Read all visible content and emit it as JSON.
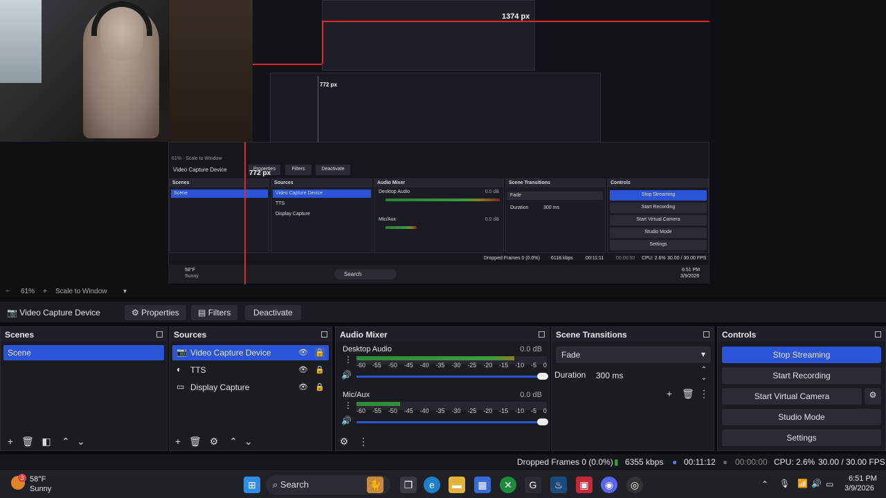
{
  "preview": {
    "measure_top": "1374 px",
    "measure_left": "772 px",
    "nested_measure_left": "772 px",
    "nested": {
      "source_name": "Video Capture Device",
      "properties": "Properties",
      "filters": "Filters",
      "deactivate": "Deactivate",
      "scale_label": "Scale to Window",
      "zoom": "61%",
      "scenes_title": "Scenes",
      "sources_title": "Sources",
      "mixer_title": "Audio Mixer",
      "transitions_title": "Scene Transitions",
      "controls_title": "Controls",
      "scene": "Scene",
      "sources": [
        "Video Capture Device",
        "TTS",
        "Display Capture"
      ],
      "desktop_audio": "Desktop Audio",
      "mic_aux": "Mic/Aux",
      "db": "0.0 dB",
      "transition": "Fade",
      "duration_label": "Duration",
      "duration": "300 ms",
      "controls": [
        "Stop Streaming",
        "Start Recording",
        "Start Virtual Camera",
        "Studio Mode",
        "Settings"
      ],
      "status_text": "Dropped Frames 0 (0.0%)",
      "kbps": "6118 kbps",
      "time": "00:11:11",
      "rec_time": "00:00:00",
      "cpu": "CPU: 2.6%",
      "fps": "30.00 / 30.00 FPS",
      "weather_temp": "58°F",
      "weather_desc": "Sunny",
      "search": "Search",
      "clock_time": "6:51 PM",
      "clock_date": "3/9/2026"
    }
  },
  "zoombar": {
    "zoom": "61%",
    "scale_mode": "Scale to Window"
  },
  "sourcebar": {
    "source_name": "Video Capture Device",
    "properties": "Properties",
    "filters": "Filters",
    "deactivate": "Deactivate"
  },
  "scenes": {
    "title": "Scenes",
    "items": [
      "Scene"
    ]
  },
  "sources": {
    "title": "Sources",
    "items": [
      "Video Capture Device",
      "TTS",
      "Display Capture"
    ]
  },
  "mixer": {
    "title": "Audio Mixer",
    "channels": [
      {
        "name": "Desktop Audio",
        "db": "0.0 dB",
        "level": 0.83
      },
      {
        "name": "Mic/Aux",
        "db": "0.0 dB",
        "level": 0.23
      }
    ],
    "ticks": [
      "-60",
      "-55",
      "-50",
      "-45",
      "-40",
      "-35",
      "-30",
      "-25",
      "-20",
      "-15",
      "-10",
      "-5",
      "0"
    ]
  },
  "transitions": {
    "title": "Scene Transitions",
    "selected": "Fade",
    "duration_label": "Duration",
    "duration": "300 ms"
  },
  "controls": {
    "title": "Controls",
    "stop_streaming": "Stop Streaming",
    "start_recording": "Start Recording",
    "start_virtual_camera": "Start Virtual Camera",
    "studio_mode": "Studio Mode",
    "settings": "Settings"
  },
  "status": {
    "dropped": "Dropped Frames 0 (0.0%)",
    "kbps": "6355 kbps",
    "stream_time": "00:11:12",
    "rec_time": "00:00:00",
    "cpu": "CPU: 2.6%",
    "fps": "30.00 / 30.00 FPS"
  },
  "taskbar": {
    "weather_badge": "3",
    "temp": "58°F",
    "weather": "Sunny",
    "search": "Search",
    "time": "6:51 PM",
    "date": "3/9/2026"
  },
  "colors": {
    "accent": "#2c54d6",
    "panel": "#1b1c22",
    "meter_green": "#3c9a3e",
    "meter_yellow": "#8a7d25",
    "meter_red": "#7a2525",
    "measure_red": "#e0262d"
  }
}
